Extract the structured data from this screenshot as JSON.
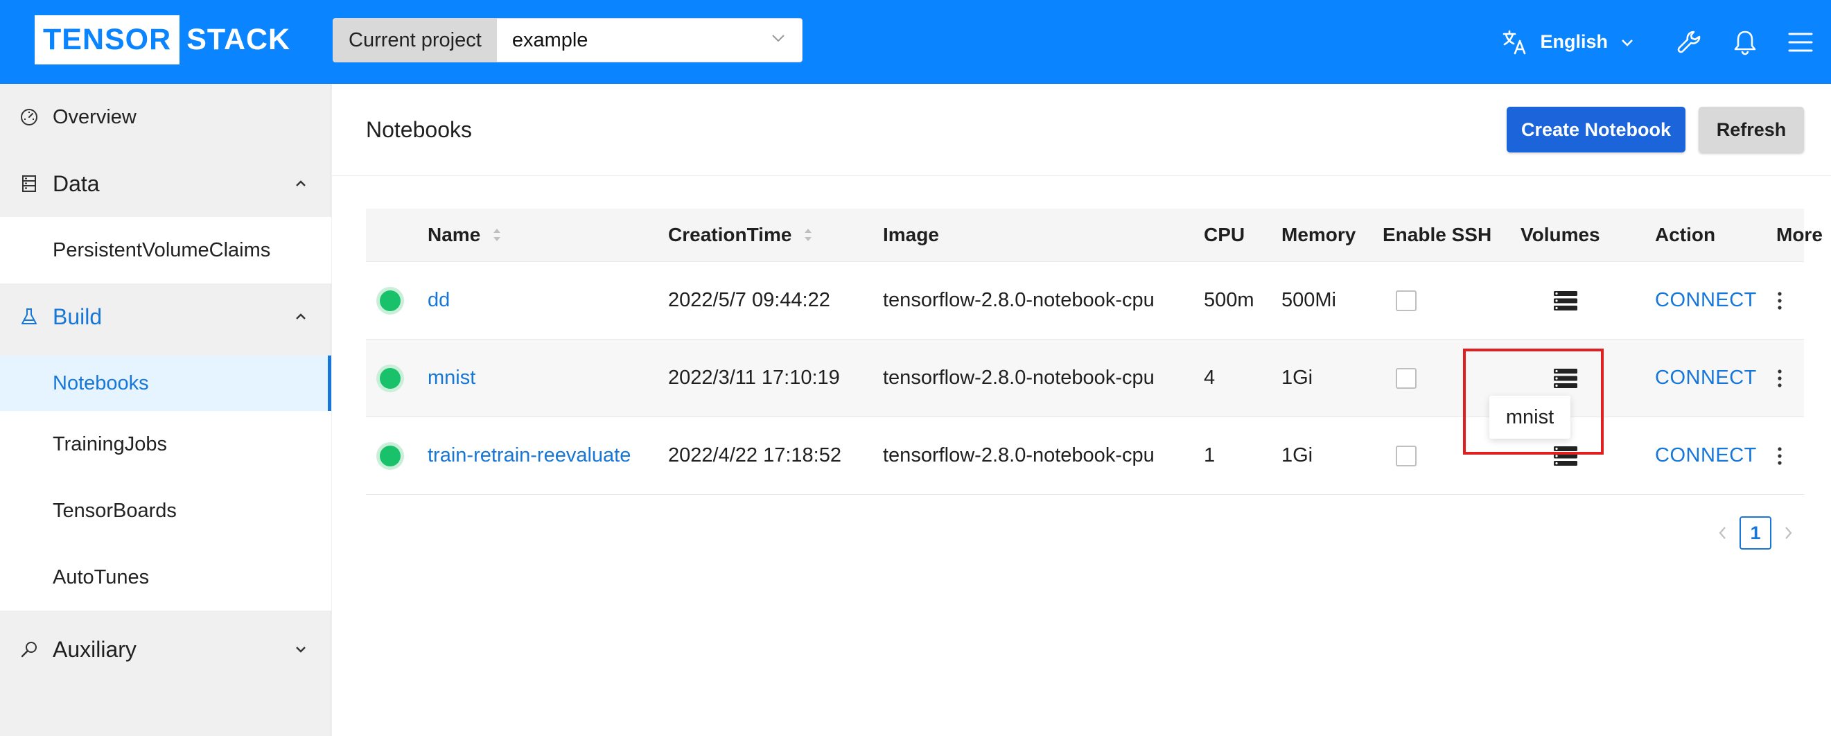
{
  "header": {
    "logo_a": "TENSOR",
    "logo_b": "STACK",
    "project_label": "Current project",
    "project_value": "example",
    "language": "English",
    "icons": [
      "translate-icon",
      "wrench-icon",
      "bell-icon",
      "menu-icon"
    ]
  },
  "sidebar": {
    "overview": "Overview",
    "data": {
      "label": "Data",
      "items": [
        "PersistentVolumeClaims"
      ]
    },
    "build": {
      "label": "Build",
      "items": [
        "Notebooks",
        "TrainingJobs",
        "TensorBoards",
        "AutoTunes"
      ],
      "selected": "Notebooks"
    },
    "auxiliary": {
      "label": "Auxiliary"
    }
  },
  "main": {
    "title": "Notebooks",
    "create_label": "Create Notebook",
    "refresh_label": "Refresh",
    "columns": {
      "name": "Name",
      "creation_time": "CreationTime",
      "image": "Image",
      "cpu": "CPU",
      "memory": "Memory",
      "ssh": "Enable SSH",
      "volumes": "Volumes",
      "action": "Action",
      "more": "More"
    },
    "rows": [
      {
        "name": "dd",
        "creation_time": "2022/5/7 09:44:22",
        "image": "tensorflow-2.8.0-notebook-cpu",
        "cpu": "500m",
        "memory": "500Mi",
        "action": "CONNECT"
      },
      {
        "name": "mnist",
        "creation_time": "2022/3/11 17:10:19",
        "image": "tensorflow-2.8.0-notebook-cpu",
        "cpu": "4",
        "memory": "1Gi",
        "action": "CONNECT"
      },
      {
        "name": "train-retrain-reevaluate",
        "creation_time": "2022/4/22 17:18:52",
        "image": "tensorflow-2.8.0-notebook-cpu",
        "cpu": "1",
        "memory": "1Gi",
        "action": "CONNECT"
      }
    ],
    "tooltip": "mnist",
    "pagination": {
      "current": "1"
    }
  },
  "colors": {
    "header": "#0a84ff",
    "accent": "#1677d9",
    "status_running": "#19c16b",
    "highlight": "#e02020"
  }
}
